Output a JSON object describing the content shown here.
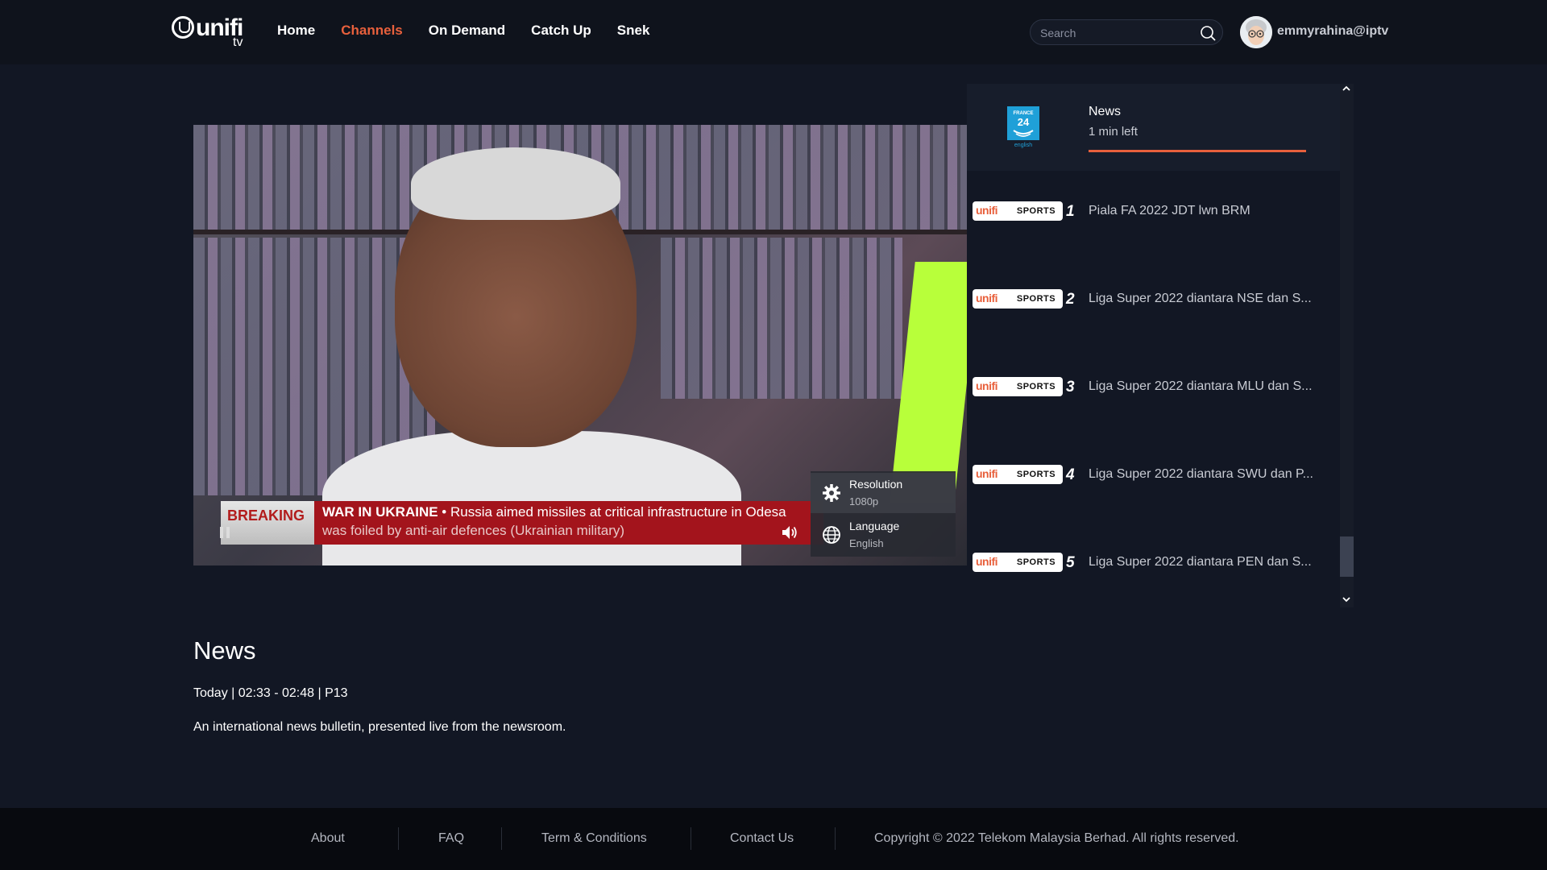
{
  "header": {
    "logo_text": "unifi",
    "logo_sub": "tv",
    "nav": [
      {
        "label": "Home",
        "active": false
      },
      {
        "label": "Channels",
        "active": true
      },
      {
        "label": "On Demand",
        "active": false
      },
      {
        "label": "Catch Up",
        "active": false
      },
      {
        "label": "Snek",
        "active": false
      }
    ],
    "search_placeholder": "Search",
    "username": "emmyrahina@iptv"
  },
  "player": {
    "ticker_breaking": "BREAKING",
    "ticker_headline_bold": "WAR IN UKRAINE",
    "ticker_headline_rest": " • Russia aimed missiles at critical infrastructure in Odesa",
    "ticker_line2": "was foiled by anti-air defences (Ukrainian military)",
    "settings": [
      {
        "title": "Resolution",
        "value": "1080p",
        "icon": "gear-icon"
      },
      {
        "title": "Language",
        "value": "English",
        "icon": "globe-icon"
      }
    ]
  },
  "current_channel": {
    "logo_text": "FRANCE 24 english",
    "title": "News",
    "time_left": "1 min left",
    "progress_fraction": 1.0
  },
  "channels": [
    {
      "num": "1",
      "badge_brand": "unifi",
      "badge_label": "SPORTS",
      "title": "Piala FA 2022 JDT lwn BRM"
    },
    {
      "num": "2",
      "badge_brand": "unifi",
      "badge_label": "SPORTS",
      "title": "Liga Super 2022 diantara NSE dan S..."
    },
    {
      "num": "3",
      "badge_brand": "unifi",
      "badge_label": "SPORTS",
      "title": "Liga Super 2022 diantara MLU dan S..."
    },
    {
      "num": "4",
      "badge_brand": "unifi",
      "badge_label": "SPORTS",
      "title": "Liga Super 2022 diantara SWU dan P..."
    },
    {
      "num": "5",
      "badge_brand": "unifi",
      "badge_label": "SPORTS",
      "title": "Liga Super 2022 diantara PEN dan S..."
    }
  ],
  "program": {
    "title": "News",
    "meta": "Today  |  02:33 - 02:48  |  P13",
    "description": "An international news bulletin, presented live from the newsroom."
  },
  "footer": {
    "links": [
      "About",
      "FAQ",
      "Term & Conditions",
      "Contact Us"
    ],
    "copyright": "Copyright © 2022 Telekom Malaysia Berhad. All rights reserved."
  },
  "colors": {
    "accent": "#e8603c",
    "background": "#121724",
    "footer_bg": "#080a0f"
  }
}
